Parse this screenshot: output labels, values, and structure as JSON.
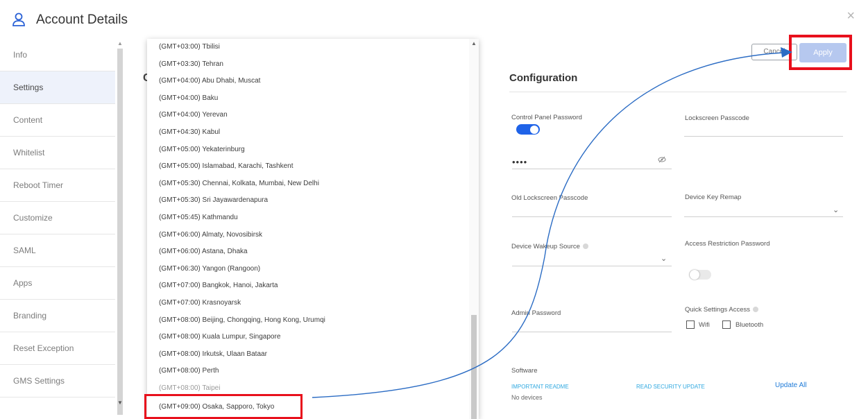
{
  "header": {
    "title": "Account Details",
    "close_glyph": "×"
  },
  "sidebar": {
    "items": [
      {
        "label": "Info"
      },
      {
        "label": "Settings"
      },
      {
        "label": "Content"
      },
      {
        "label": "Whitelist"
      },
      {
        "label": "Reboot Timer"
      },
      {
        "label": "Customize"
      },
      {
        "label": "SAML"
      },
      {
        "label": "Apps"
      },
      {
        "label": "Branding"
      },
      {
        "label": "Reset Exception"
      },
      {
        "label": "GMS Settings"
      }
    ],
    "active_index": 1
  },
  "behind_heading_fragment": "C",
  "timezone_list": {
    "items": [
      "(GMT+03:00) Tbilisi",
      "(GMT+03:30) Tehran",
      "(GMT+04:00) Abu Dhabi, Muscat",
      "(GMT+04:00) Baku",
      "(GMT+04:00) Yerevan",
      "(GMT+04:30) Kabul",
      "(GMT+05:00) Yekaterinburg",
      "(GMT+05:00) Islamabad, Karachi, Tashkent",
      "(GMT+05:30) Chennai, Kolkata, Mumbai, New Delhi",
      "(GMT+05:30) Sri Jayawardenapura",
      "(GMT+05:45) Kathmandu",
      "(GMT+06:00) Almaty, Novosibirsk",
      "(GMT+06:00) Astana, Dhaka",
      "(GMT+06:30) Yangon (Rangoon)",
      "(GMT+07:00) Bangkok, Hanoi, Jakarta",
      "(GMT+07:00) Krasnoyarsk",
      "(GMT+08:00) Beijing, Chongqing, Hong Kong, Urumqi",
      "(GMT+08:00) Kuala Lumpur, Singapore",
      "(GMT+08:00) Irkutsk, Ulaan Bataar",
      "(GMT+08:00) Perth",
      "(GMT+08:00) Taipei",
      "(GMT+09:00) Osaka, Sapporo, Tokyo"
    ],
    "highlighted_index": 21
  },
  "actions": {
    "cancel_label": "Cancel",
    "apply_label": "Apply"
  },
  "configuration": {
    "title": "Configuration",
    "control_panel_password_label": "Control Panel Password",
    "control_panel_password_toggle": true,
    "control_panel_password_value": "••••",
    "lockscreen_passcode_label": "Lockscreen Passcode",
    "old_lockscreen_passcode_label": "Old Lockscreen Passcode",
    "device_key_remap_label": "Device Key Remap",
    "device_wakeup_source_label": "Device Wakeup Source",
    "access_restriction_password_label": "Access Restriction Password",
    "access_restriction_toggle": false,
    "admin_password_label": "Admin Password",
    "quick_settings_access_label": "Quick Settings Access",
    "wifi_label": "Wifi",
    "bluetooth_label": "Bluetooth"
  },
  "software": {
    "label": "Software",
    "important_readme": "Important Readme",
    "read_security_update": "Read Security Update",
    "update_all": "Update All",
    "no_devices": "No devices"
  },
  "colors": {
    "highlight_red": "#e8101c",
    "accent_blue": "#1f63e8",
    "apply_disabled": "#b6c8ef",
    "link_blue": "#2fa8e0",
    "arrow_blue": "#2b6cc4"
  }
}
